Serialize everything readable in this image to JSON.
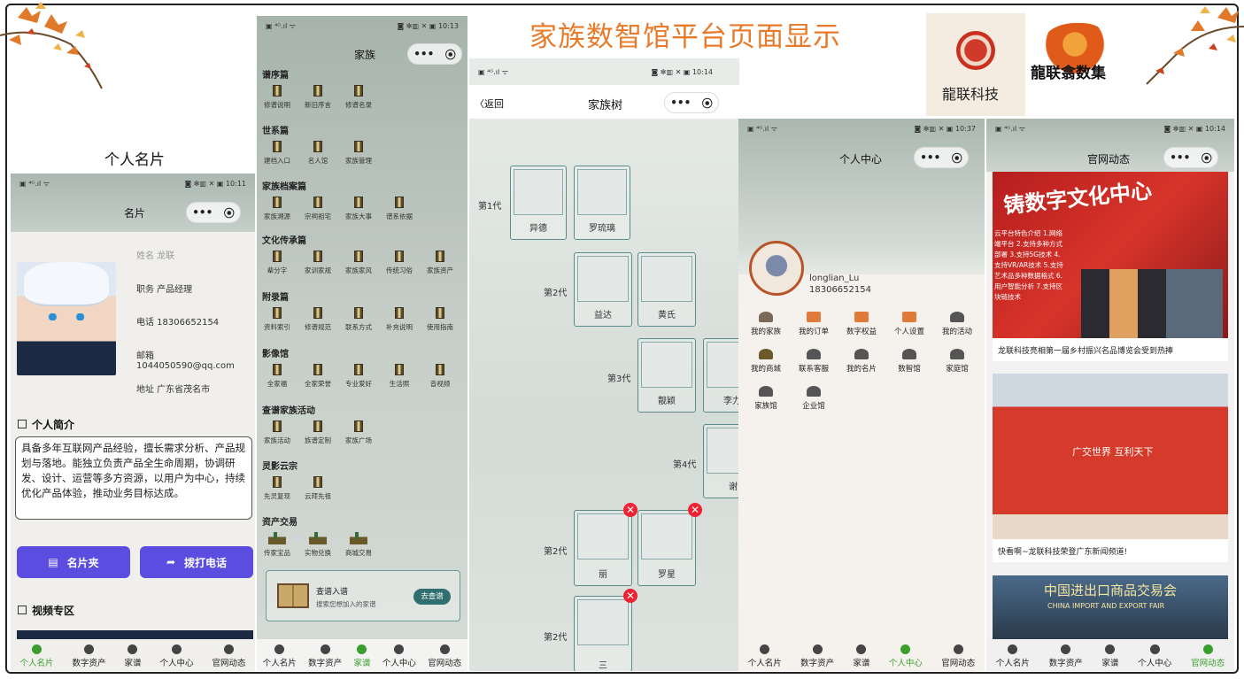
{
  "banner_title": "家族数智馆平台页面显示",
  "brand": {
    "logo1_text": "龍联科技",
    "logo2_text": "龍联翕数集"
  },
  "panel1": {
    "heading": "个人名片",
    "status_left": "▣ ⁴ᴳ.ıl ᯤ",
    "status_right": "◙ ✻▥ ✕ ▣ 10:11",
    "nav_title": "名片",
    "fields": {
      "name": "姓名  龙联",
      "role": "职务 产品经理",
      "phone": "电话 18306652154",
      "email": "邮箱 1044050590@qq.com",
      "address": "地址 广东省茂名市"
    },
    "intro_title": "个人简介",
    "intro_text": "具备多年互联网产品经验，擅长需求分析、产品规划与落地。能独立负责产品全生命周期，协调研发、设计、运营等多方资源，以用户为中心，持续优化产品体验，推动业务目标达成。",
    "btn_cardholder": "名片夹",
    "btn_call": "拨打电话",
    "video_title": "视频专区"
  },
  "panel2": {
    "status_right": "◙ ✻▥ ✕ ▣ 10:13",
    "nav_title": "家族",
    "sections": [
      {
        "title": "谱序篇",
        "items": [
          "修谱说明",
          "新旧序言",
          "修谱名录"
        ]
      },
      {
        "title": "世系篇",
        "items": [
          "建档入口",
          "名人馆",
          "家族管理"
        ]
      },
      {
        "title": "家族档案篇",
        "items": [
          "家族溯源",
          "宗祠祖宅",
          "家族大事",
          "谱系依据"
        ]
      },
      {
        "title": "文化传承篇",
        "items": [
          "辈分字",
          "家训家规",
          "家族家风",
          "传统习俗",
          "家族资产"
        ]
      },
      {
        "title": "附录篇",
        "items": [
          "资料索引",
          "修谱规范",
          "联系方式",
          "补充说明",
          "使用指南"
        ]
      },
      {
        "title": "影像馆",
        "items": [
          "全家福",
          "全家荣誉",
          "专业爱好",
          "生活照",
          "音视频"
        ]
      },
      {
        "title": "查谱家族活动",
        "items": [
          "家族活动",
          "族谱定制",
          "家族广场"
        ]
      },
      {
        "title": "灵影云宗",
        "items": [
          "先灵复现",
          "云拜先祖"
        ]
      },
      {
        "title": "资产交易",
        "items": [
          "传家宝品",
          "实物兑换",
          "商城交易"
        ]
      }
    ],
    "search_title": "查谱入谱",
    "search_sub": "搜索您想加入的家谱",
    "search_btn": "去查谱"
  },
  "panel3": {
    "status_right": "◙ ✻▥ ✕ ▣ 10:14",
    "back": "〈返回",
    "nav_title": "家族树",
    "gen1": "第1代",
    "gen2": "第2代",
    "gen3": "第3代",
    "gen4": "第4代",
    "gen2b": "第2代",
    "gen2c": "第2代",
    "nodes": [
      "异德",
      "罗琉璃",
      "益达",
      "黄氏",
      "靓颖",
      "李力",
      "谢",
      "丽",
      "罗星",
      "三"
    ]
  },
  "panel4": {
    "status_right": "◙ ✻▥ ✕ ▣ 10:37",
    "nav_title": "个人中心",
    "username": "longlian_Lu",
    "phone": "18306652154",
    "items": [
      "我的家族",
      "我的订单",
      "数字权益",
      "个人设置",
      "我的活动",
      "我的商城",
      "联系客服",
      "我的名片",
      "数智馆",
      "家庭馆",
      "家族馆",
      "企业馆"
    ]
  },
  "panel5": {
    "status_right": "◙ ✻▥ ✕ ▣ 10:14",
    "nav_title": "官网动态",
    "img1_text": "铸数字文化中心",
    "img1_side": "云平台特色介绍 1.网络端平台 2.支持多种方式部署 3.支持5G技术 4.支持VR/AR技术 5.支持艺术品多种数据格式 6.用户智能分析 7.支持区块链技术",
    "news1": "龙联科技亮相第一届乡村振兴名品博览会受到热捧",
    "img2_text": "广交世界 互利天下",
    "news2": "快看啊~龙联科技荣登广东新闻频道!",
    "img3_text": "中国进出口商品交易会",
    "img3_sub": "CHINA IMPORT AND EXPORT FAIR"
  },
  "tabbar": [
    "个人名片",
    "数字资产",
    "家谱",
    "个人中心",
    "官网动态"
  ],
  "colors": {
    "title_orange": "#e87a2a",
    "btn_purple": "#5a4de0",
    "active_green": "#3a9e2e",
    "delete_red": "#e22233"
  }
}
